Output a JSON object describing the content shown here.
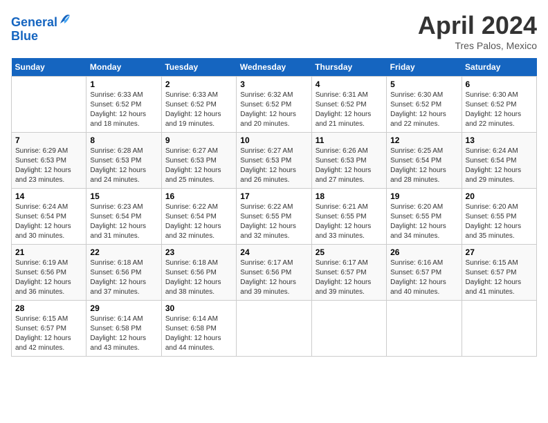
{
  "header": {
    "logo_line1": "General",
    "logo_line2": "Blue",
    "month": "April 2024",
    "location": "Tres Palos, Mexico"
  },
  "weekdays": [
    "Sunday",
    "Monday",
    "Tuesday",
    "Wednesday",
    "Thursday",
    "Friday",
    "Saturday"
  ],
  "weeks": [
    [
      {
        "day": "",
        "sunrise": "",
        "sunset": "",
        "daylight": ""
      },
      {
        "day": "1",
        "sunrise": "Sunrise: 6:33 AM",
        "sunset": "Sunset: 6:52 PM",
        "daylight": "Daylight: 12 hours and 18 minutes."
      },
      {
        "day": "2",
        "sunrise": "Sunrise: 6:33 AM",
        "sunset": "Sunset: 6:52 PM",
        "daylight": "Daylight: 12 hours and 19 minutes."
      },
      {
        "day": "3",
        "sunrise": "Sunrise: 6:32 AM",
        "sunset": "Sunset: 6:52 PM",
        "daylight": "Daylight: 12 hours and 20 minutes."
      },
      {
        "day": "4",
        "sunrise": "Sunrise: 6:31 AM",
        "sunset": "Sunset: 6:52 PM",
        "daylight": "Daylight: 12 hours and 21 minutes."
      },
      {
        "day": "5",
        "sunrise": "Sunrise: 6:30 AM",
        "sunset": "Sunset: 6:52 PM",
        "daylight": "Daylight: 12 hours and 22 minutes."
      },
      {
        "day": "6",
        "sunrise": "Sunrise: 6:30 AM",
        "sunset": "Sunset: 6:52 PM",
        "daylight": "Daylight: 12 hours and 22 minutes."
      }
    ],
    [
      {
        "day": "7",
        "sunrise": "Sunrise: 6:29 AM",
        "sunset": "Sunset: 6:53 PM",
        "daylight": "Daylight: 12 hours and 23 minutes."
      },
      {
        "day": "8",
        "sunrise": "Sunrise: 6:28 AM",
        "sunset": "Sunset: 6:53 PM",
        "daylight": "Daylight: 12 hours and 24 minutes."
      },
      {
        "day": "9",
        "sunrise": "Sunrise: 6:27 AM",
        "sunset": "Sunset: 6:53 PM",
        "daylight": "Daylight: 12 hours and 25 minutes."
      },
      {
        "day": "10",
        "sunrise": "Sunrise: 6:27 AM",
        "sunset": "Sunset: 6:53 PM",
        "daylight": "Daylight: 12 hours and 26 minutes."
      },
      {
        "day": "11",
        "sunrise": "Sunrise: 6:26 AM",
        "sunset": "Sunset: 6:53 PM",
        "daylight": "Daylight: 12 hours and 27 minutes."
      },
      {
        "day": "12",
        "sunrise": "Sunrise: 6:25 AM",
        "sunset": "Sunset: 6:54 PM",
        "daylight": "Daylight: 12 hours and 28 minutes."
      },
      {
        "day": "13",
        "sunrise": "Sunrise: 6:24 AM",
        "sunset": "Sunset: 6:54 PM",
        "daylight": "Daylight: 12 hours and 29 minutes."
      }
    ],
    [
      {
        "day": "14",
        "sunrise": "Sunrise: 6:24 AM",
        "sunset": "Sunset: 6:54 PM",
        "daylight": "Daylight: 12 hours and 30 minutes."
      },
      {
        "day": "15",
        "sunrise": "Sunrise: 6:23 AM",
        "sunset": "Sunset: 6:54 PM",
        "daylight": "Daylight: 12 hours and 31 minutes."
      },
      {
        "day": "16",
        "sunrise": "Sunrise: 6:22 AM",
        "sunset": "Sunset: 6:54 PM",
        "daylight": "Daylight: 12 hours and 32 minutes."
      },
      {
        "day": "17",
        "sunrise": "Sunrise: 6:22 AM",
        "sunset": "Sunset: 6:55 PM",
        "daylight": "Daylight: 12 hours and 32 minutes."
      },
      {
        "day": "18",
        "sunrise": "Sunrise: 6:21 AM",
        "sunset": "Sunset: 6:55 PM",
        "daylight": "Daylight: 12 hours and 33 minutes."
      },
      {
        "day": "19",
        "sunrise": "Sunrise: 6:20 AM",
        "sunset": "Sunset: 6:55 PM",
        "daylight": "Daylight: 12 hours and 34 minutes."
      },
      {
        "day": "20",
        "sunrise": "Sunrise: 6:20 AM",
        "sunset": "Sunset: 6:55 PM",
        "daylight": "Daylight: 12 hours and 35 minutes."
      }
    ],
    [
      {
        "day": "21",
        "sunrise": "Sunrise: 6:19 AM",
        "sunset": "Sunset: 6:56 PM",
        "daylight": "Daylight: 12 hours and 36 minutes."
      },
      {
        "day": "22",
        "sunrise": "Sunrise: 6:18 AM",
        "sunset": "Sunset: 6:56 PM",
        "daylight": "Daylight: 12 hours and 37 minutes."
      },
      {
        "day": "23",
        "sunrise": "Sunrise: 6:18 AM",
        "sunset": "Sunset: 6:56 PM",
        "daylight": "Daylight: 12 hours and 38 minutes."
      },
      {
        "day": "24",
        "sunrise": "Sunrise: 6:17 AM",
        "sunset": "Sunset: 6:56 PM",
        "daylight": "Daylight: 12 hours and 39 minutes."
      },
      {
        "day": "25",
        "sunrise": "Sunrise: 6:17 AM",
        "sunset": "Sunset: 6:57 PM",
        "daylight": "Daylight: 12 hours and 39 minutes."
      },
      {
        "day": "26",
        "sunrise": "Sunrise: 6:16 AM",
        "sunset": "Sunset: 6:57 PM",
        "daylight": "Daylight: 12 hours and 40 minutes."
      },
      {
        "day": "27",
        "sunrise": "Sunrise: 6:15 AM",
        "sunset": "Sunset: 6:57 PM",
        "daylight": "Daylight: 12 hours and 41 minutes."
      }
    ],
    [
      {
        "day": "28",
        "sunrise": "Sunrise: 6:15 AM",
        "sunset": "Sunset: 6:57 PM",
        "daylight": "Daylight: 12 hours and 42 minutes."
      },
      {
        "day": "29",
        "sunrise": "Sunrise: 6:14 AM",
        "sunset": "Sunset: 6:58 PM",
        "daylight": "Daylight: 12 hours and 43 minutes."
      },
      {
        "day": "30",
        "sunrise": "Sunrise: 6:14 AM",
        "sunset": "Sunset: 6:58 PM",
        "daylight": "Daylight: 12 hours and 44 minutes."
      },
      {
        "day": "",
        "sunrise": "",
        "sunset": "",
        "daylight": ""
      },
      {
        "day": "",
        "sunrise": "",
        "sunset": "",
        "daylight": ""
      },
      {
        "day": "",
        "sunrise": "",
        "sunset": "",
        "daylight": ""
      },
      {
        "day": "",
        "sunrise": "",
        "sunset": "",
        "daylight": ""
      }
    ]
  ]
}
